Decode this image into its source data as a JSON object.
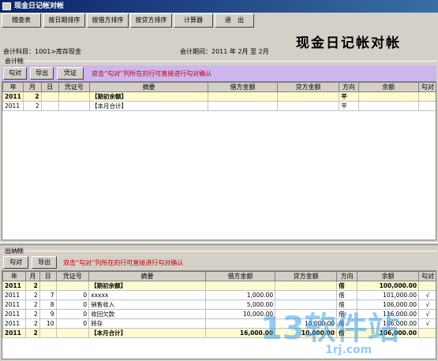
{
  "window": {
    "title": "现金日记帐对帐"
  },
  "toolbar": {
    "buttons": [
      "稽查表",
      "按日期排序",
      "按借方排序",
      "按贷方排序",
      "计算器",
      "退　出"
    ]
  },
  "page_title": "现金日记帐对帐",
  "subject_label": "会计科目：1001>库存现金",
  "period_label": "会计期间：2011 年  2月 至  2月",
  "accounting": {
    "group_label": "会计帐",
    "buttons": [
      "勾对",
      "导出",
      "凭证"
    ],
    "hint": "双击“勾对”列所在的行可直接进行勾对确认",
    "columns": [
      "年",
      "月",
      "日",
      "凭证号",
      "摘要",
      "借方金额",
      "贷方金额",
      "方向",
      "余额",
      "勾对"
    ],
    "rows": [
      {
        "year": "2011",
        "month": "2",
        "day": "",
        "voucher": "",
        "summary": "【期初余额】",
        "debit": "",
        "credit": "",
        "direction": "平",
        "balance": "",
        "check": "",
        "summary_row": true
      },
      {
        "year": "2011",
        "month": "2",
        "day": "",
        "voucher": "",
        "summary": "【本月合计】",
        "debit": "",
        "credit": "",
        "direction": "平",
        "balance": "",
        "check": "",
        "summary_row": false
      }
    ]
  },
  "cashier": {
    "group_label": "出纳帐",
    "buttons": [
      "勾对",
      "导出"
    ],
    "hint": "双击“勾对”列所在的行可直接进行勾对确认",
    "columns": [
      "年",
      "月",
      "日",
      "凭证号",
      "摘要",
      "借方金额",
      "贷方金额",
      "方向",
      "余额",
      "勾对"
    ],
    "rows": [
      {
        "year": "2011",
        "month": "2",
        "day": "",
        "voucher": "",
        "summary": "【期初余额】",
        "debit": "",
        "credit": "",
        "direction": "借",
        "balance": "100,000.00",
        "check": "",
        "summary_row": true
      },
      {
        "year": "2011",
        "month": "2",
        "day": "7",
        "voucher": "0",
        "summary": "xxxxx",
        "debit": "1,000.00",
        "credit": "",
        "direction": "借",
        "balance": "101,000.00",
        "check": "√",
        "summary_row": false
      },
      {
        "year": "2011",
        "month": "2",
        "day": "8",
        "voucher": "0",
        "summary": "销售收入",
        "debit": "5,000.00",
        "credit": "",
        "direction": "借",
        "balance": "106,000.00",
        "check": "√",
        "summary_row": false
      },
      {
        "year": "2011",
        "month": "2",
        "day": "9",
        "voucher": "0",
        "summary": "收回欠款",
        "debit": "10,000.00",
        "credit": "",
        "direction": "借",
        "balance": "116,000.00",
        "check": "√",
        "summary_row": false
      },
      {
        "year": "2011",
        "month": "2",
        "day": "10",
        "voucher": "0",
        "summary": "转存",
        "debit": "",
        "credit": "10,000.00",
        "direction": "借",
        "balance": "106,000.00",
        "check": "√",
        "summary_row": false
      },
      {
        "year": "2011",
        "month": "2",
        "day": "",
        "voucher": "",
        "summary": "【本月合计】",
        "debit": "16,000.00",
        "credit": "10,000.00",
        "direction": "借",
        "balance": "106,000.00",
        "check": "",
        "summary_row": true
      }
    ]
  },
  "watermark": {
    "big": "13软件站",
    "small": "1rj.com"
  },
  "colors": {
    "titlebar": "#0a246a",
    "actionbar": "#cdb6f0",
    "summary_row": "#fffbd0",
    "hint": "#c00000"
  }
}
